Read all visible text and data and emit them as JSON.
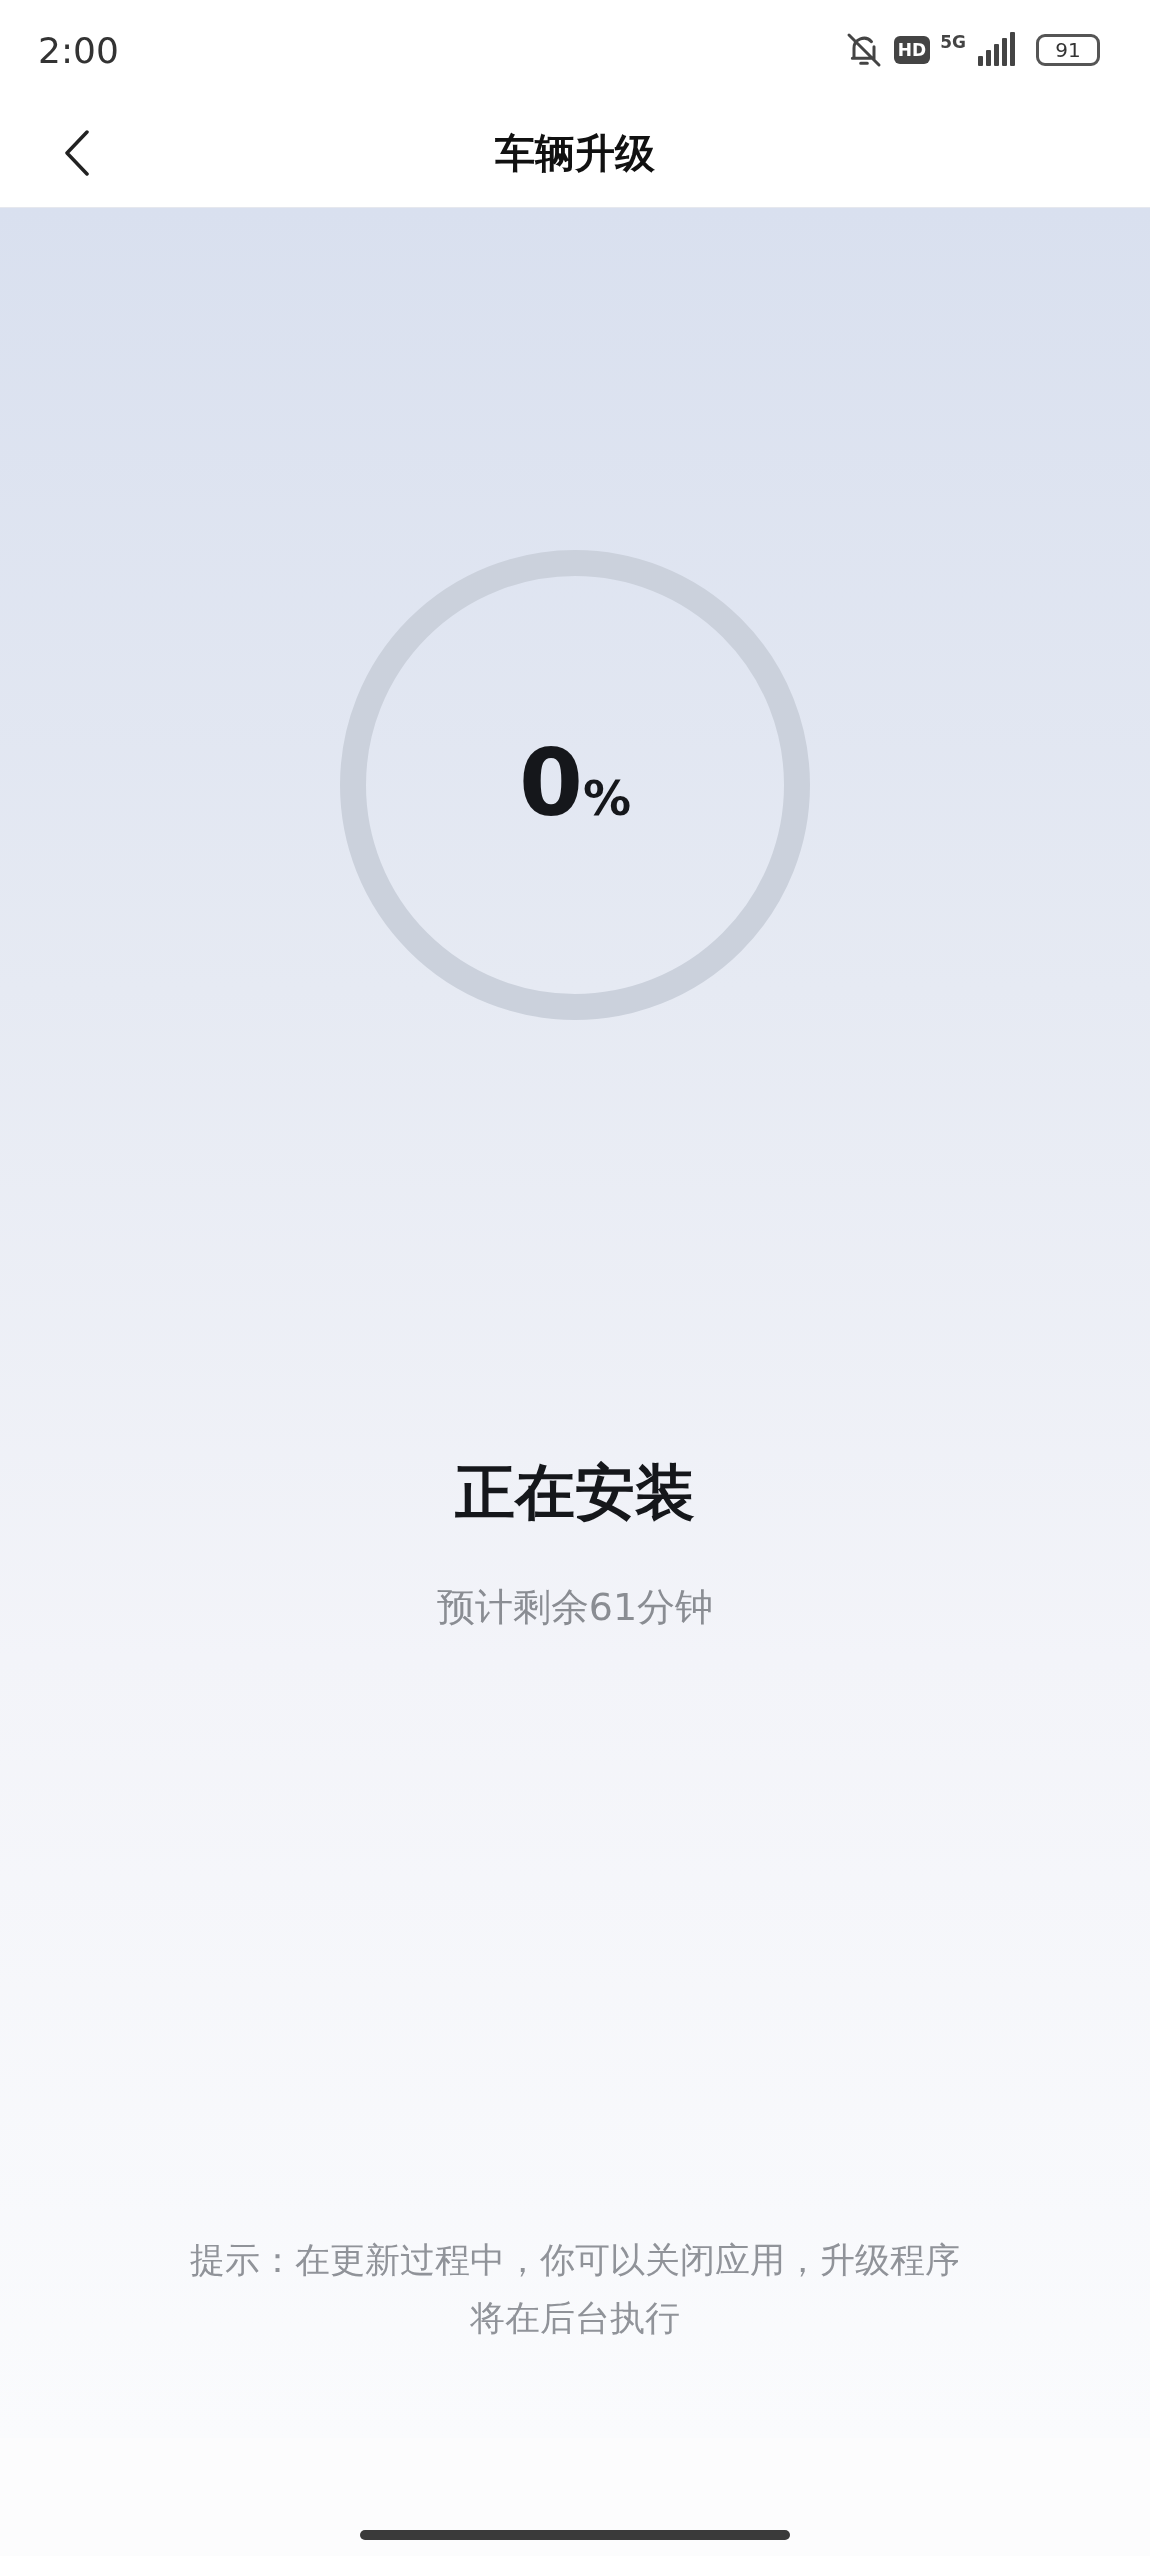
{
  "status_bar": {
    "time": "2:00",
    "hd_badge": "HD",
    "network": "5G",
    "battery": "91"
  },
  "nav": {
    "title": "车辆升级"
  },
  "progress": {
    "value": "0",
    "unit": "%"
  },
  "status": {
    "title": "正在安装",
    "remaining": "预计剩余61分钟"
  },
  "tip": "提示：在更新过程中，你可以关闭应用，升级程序将在后台执行"
}
